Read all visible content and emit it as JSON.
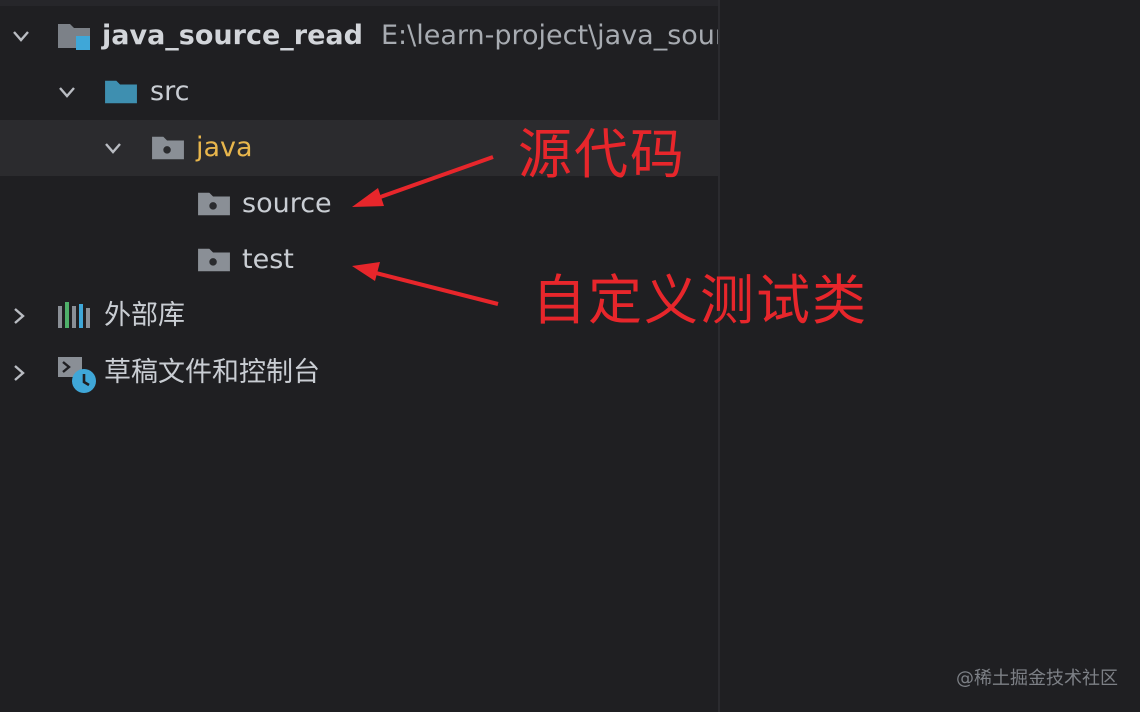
{
  "project": {
    "name": "java_source_read",
    "path": "E:\\learn-project\\java_source"
  },
  "tree": {
    "src": "src",
    "java": "java",
    "source": "source",
    "test": "test",
    "external_libraries": "外部库",
    "scratches": "草稿文件和控制台"
  },
  "annotations": {
    "source_code": "源代码",
    "custom_test": "自定义测试类"
  },
  "watermark": "@稀土掘金技术社区",
  "colors": {
    "background": "#1f1f22",
    "selected_row": "#2b2b2e",
    "text": "#c9cdd3",
    "java_folder_text": "#e8b64c",
    "annotation_red": "#e7262b",
    "src_folder": "#3e8fb0"
  }
}
